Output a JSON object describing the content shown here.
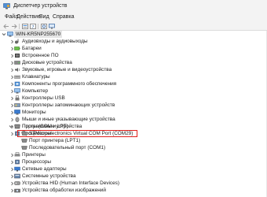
{
  "window": {
    "title": "Диспетчер устройств"
  },
  "menu": [
    "Файл",
    "Действие",
    "Вид",
    "Справка"
  ],
  "toolbar": [
    "back-arrow-icon",
    "forward-arrow-icon",
    "properties-panel-icon",
    "help-icon",
    "scan-hardware-icon",
    "monitor-icon"
  ],
  "tree": {
    "root": "WIN-KR5NP255670",
    "categories": [
      {
        "label": "Аудиовходы и аудиовыходы",
        "icon": "audio-icon"
      },
      {
        "label": "Батареи",
        "icon": "battery-icon"
      },
      {
        "label": "Встроенное ПО",
        "icon": "firmware-icon"
      },
      {
        "label": "Дисковые устройства",
        "icon": "disk-icon"
      },
      {
        "label": "Звуковые, игровые и видеоустройства",
        "icon": "speaker-icon"
      },
      {
        "label": "Клавиатуры",
        "icon": "keyboard-icon"
      },
      {
        "label": "Компоненты программного обеспечения",
        "icon": "software-component-icon"
      },
      {
        "label": "Компьютер",
        "icon": "computer-icon"
      },
      {
        "label": "Контроллеры USB",
        "icon": "usb-icon"
      },
      {
        "label": "Контроллеры запоминающих устройств",
        "icon": "storage-controller-icon"
      },
      {
        "label": "Мониторы",
        "icon": "monitor-icon"
      },
      {
        "label": "Мыши и иные указывающие устройства",
        "icon": "mouse-icon"
      },
      {
        "label": "Программные устройства",
        "icon": "software-device-icon"
      },
      {
        "label": "Процессоры",
        "icon": "processor-icon"
      }
    ],
    "ports_category": "Порты (COM и LPT)",
    "ports": [
      {
        "label": "STMicroelectronics Virtual COM Port (COM29)",
        "highlighted": true
      },
      {
        "label": "Порт принтера (LPT1)",
        "highlighted": false
      },
      {
        "label": "Последовательный порт (COM1)",
        "highlighted": false
      }
    ],
    "categories_after": [
      {
        "label": "Принтеры",
        "icon": "printer-icon"
      },
      {
        "label": "Процессоры",
        "icon": "processor-icon"
      },
      {
        "label": "Сетевые адаптеры",
        "icon": "network-icon"
      },
      {
        "label": "Системные устройства",
        "icon": "system-device-icon"
      },
      {
        "label": "Устройства HID (Human Interface Devices)",
        "icon": "hid-icon"
      },
      {
        "label": "Устройства обработки изображений",
        "icon": "camera-icon"
      }
    ]
  },
  "colors": {
    "highlight_border": "#e0201b",
    "root_selection": "#e5e5e5",
    "chrome_bg": "#f3f3f3"
  }
}
